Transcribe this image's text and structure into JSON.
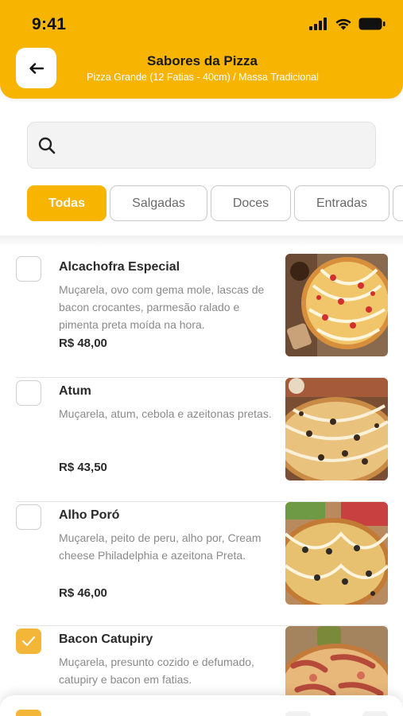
{
  "status_bar": {
    "time": "9:41"
  },
  "header": {
    "title": "Sabores da Pizza",
    "subtitle": "Pizza Grande (12 Fatias - 40cm) / Massa Tradicional"
  },
  "search": {
    "placeholder": "",
    "value": ""
  },
  "tabs": [
    {
      "label": "Todas",
      "active": true
    },
    {
      "label": "Salgadas",
      "active": false
    },
    {
      "label": "Doces",
      "active": false
    },
    {
      "label": "Entradas",
      "active": false
    }
  ],
  "items": [
    {
      "name": "Alcachofra Especial",
      "description": "Muçarela, ovo com gema mole, lascas de bacon crocantes, parmesão ralado e pimenta preta moída na hora.",
      "price": "R$ 48,00",
      "checked": false
    },
    {
      "name": "Atum",
      "description": "Muçarela, atum, cebola e azeitonas pretas.",
      "price": "R$ 43,50",
      "checked": false
    },
    {
      "name": "Alho Poró",
      "description": "Muçarela, peito de peru, alho por, Cream cheese Philadelphia e azeitona Preta.",
      "price": "R$ 46,00",
      "checked": false
    },
    {
      "name": "Bacon Catupiry",
      "description": "Muçarela, presunto cozido e defumado, catupiry e bacon em fatias.",
      "price": "",
      "checked": true
    }
  ],
  "colors": {
    "brand": "#f7b400",
    "checkbox_checked": "#f3b638",
    "muted_text": "#8a8a8a"
  },
  "icons": [
    "back-arrow-icon",
    "search-icon",
    "signal-icon",
    "wifi-icon",
    "battery-icon",
    "check-icon"
  ]
}
